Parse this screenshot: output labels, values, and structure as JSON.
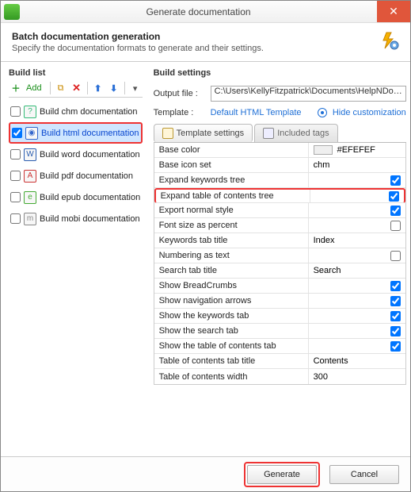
{
  "window": {
    "title": "Generate documentation"
  },
  "header": {
    "title": "Batch documentation generation",
    "subtitle": "Specify the documentation formats to generate and their settings."
  },
  "buildlist": {
    "label": "Build list",
    "add": "Add",
    "items": [
      {
        "label": "Build chm documentation",
        "checked": false
      },
      {
        "label": "Build html documentation",
        "checked": true
      },
      {
        "label": "Build word documentation",
        "checked": false
      },
      {
        "label": "Build pdf documentation",
        "checked": false
      },
      {
        "label": "Build epub documentation",
        "checked": false
      },
      {
        "label": "Build mobi documentation",
        "checked": false
      }
    ]
  },
  "buildsettings": {
    "label": "Build settings",
    "outputfile_label": "Output file :",
    "outputfile_value": "C:\\Users\\KellyFitzpatrick\\Documents\\HelpNDo…",
    "template_label": "Template :",
    "template_link": "Default HTML Template",
    "hide_customization": "Hide customization",
    "tabs": {
      "settings": "Template settings",
      "tags": "Included tags"
    },
    "props": [
      {
        "name": "Base color",
        "type": "color",
        "value": "#EFEFEF"
      },
      {
        "name": "Base icon set",
        "type": "text",
        "value": "chm"
      },
      {
        "name": "Expand keywords tree",
        "type": "check",
        "value": true
      },
      {
        "name": "Expand table of contents tree",
        "type": "check",
        "value": true,
        "highlight": true
      },
      {
        "name": "Export normal style",
        "type": "check",
        "value": true
      },
      {
        "name": "Font size as percent",
        "type": "check",
        "value": false
      },
      {
        "name": "Keywords tab title",
        "type": "text",
        "value": "Index"
      },
      {
        "name": "Numbering as text",
        "type": "check",
        "value": false
      },
      {
        "name": "Search tab title",
        "type": "text",
        "value": "Search"
      },
      {
        "name": "Show BreadCrumbs",
        "type": "check",
        "value": true
      },
      {
        "name": "Show navigation arrows",
        "type": "check",
        "value": true
      },
      {
        "name": "Show the keywords tab",
        "type": "check",
        "value": true
      },
      {
        "name": "Show the search tab",
        "type": "check",
        "value": true
      },
      {
        "name": "Show the table of contents tab",
        "type": "check",
        "value": true
      },
      {
        "name": "Table of contents tab title",
        "type": "text",
        "value": "Contents"
      },
      {
        "name": "Table of contents width",
        "type": "text",
        "value": "300"
      }
    ]
  },
  "footer": {
    "generate": "Generate",
    "cancel": "Cancel"
  }
}
